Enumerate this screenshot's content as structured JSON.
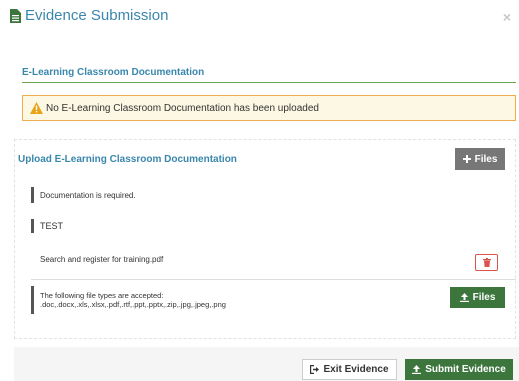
{
  "header": {
    "title": "Evidence Submission",
    "close_glyph": "×"
  },
  "section": {
    "title": "E-Learning Classroom Documentation"
  },
  "alert": {
    "text": "No E-Learning Classroom Documentation has been uploaded",
    "icon": "warning-icon",
    "color": "#f0ad4e"
  },
  "upload": {
    "title": "Upload E-Learning Classroom Documentation",
    "files_button_label": "Files",
    "required_note": "Documentation is required.",
    "test_note": "TEST",
    "file_name": "Search and register for training.pdf",
    "accepted_line1": "The following file types are accepted:",
    "accepted_line2": ".doc,.docx,.xls,.xlsx,.pdf,.rtf,.ppt,.pptx,.zip,.jpg,.jpeg,.png",
    "upload_files_label": "Files"
  },
  "footer": {
    "exit_label": "Exit Evidence",
    "submit_label": "Submit Evidence"
  },
  "colors": {
    "accent": "#3a87ad",
    "success": "#3c763d",
    "danger": "#d9534f",
    "grey_button": "#777777"
  }
}
